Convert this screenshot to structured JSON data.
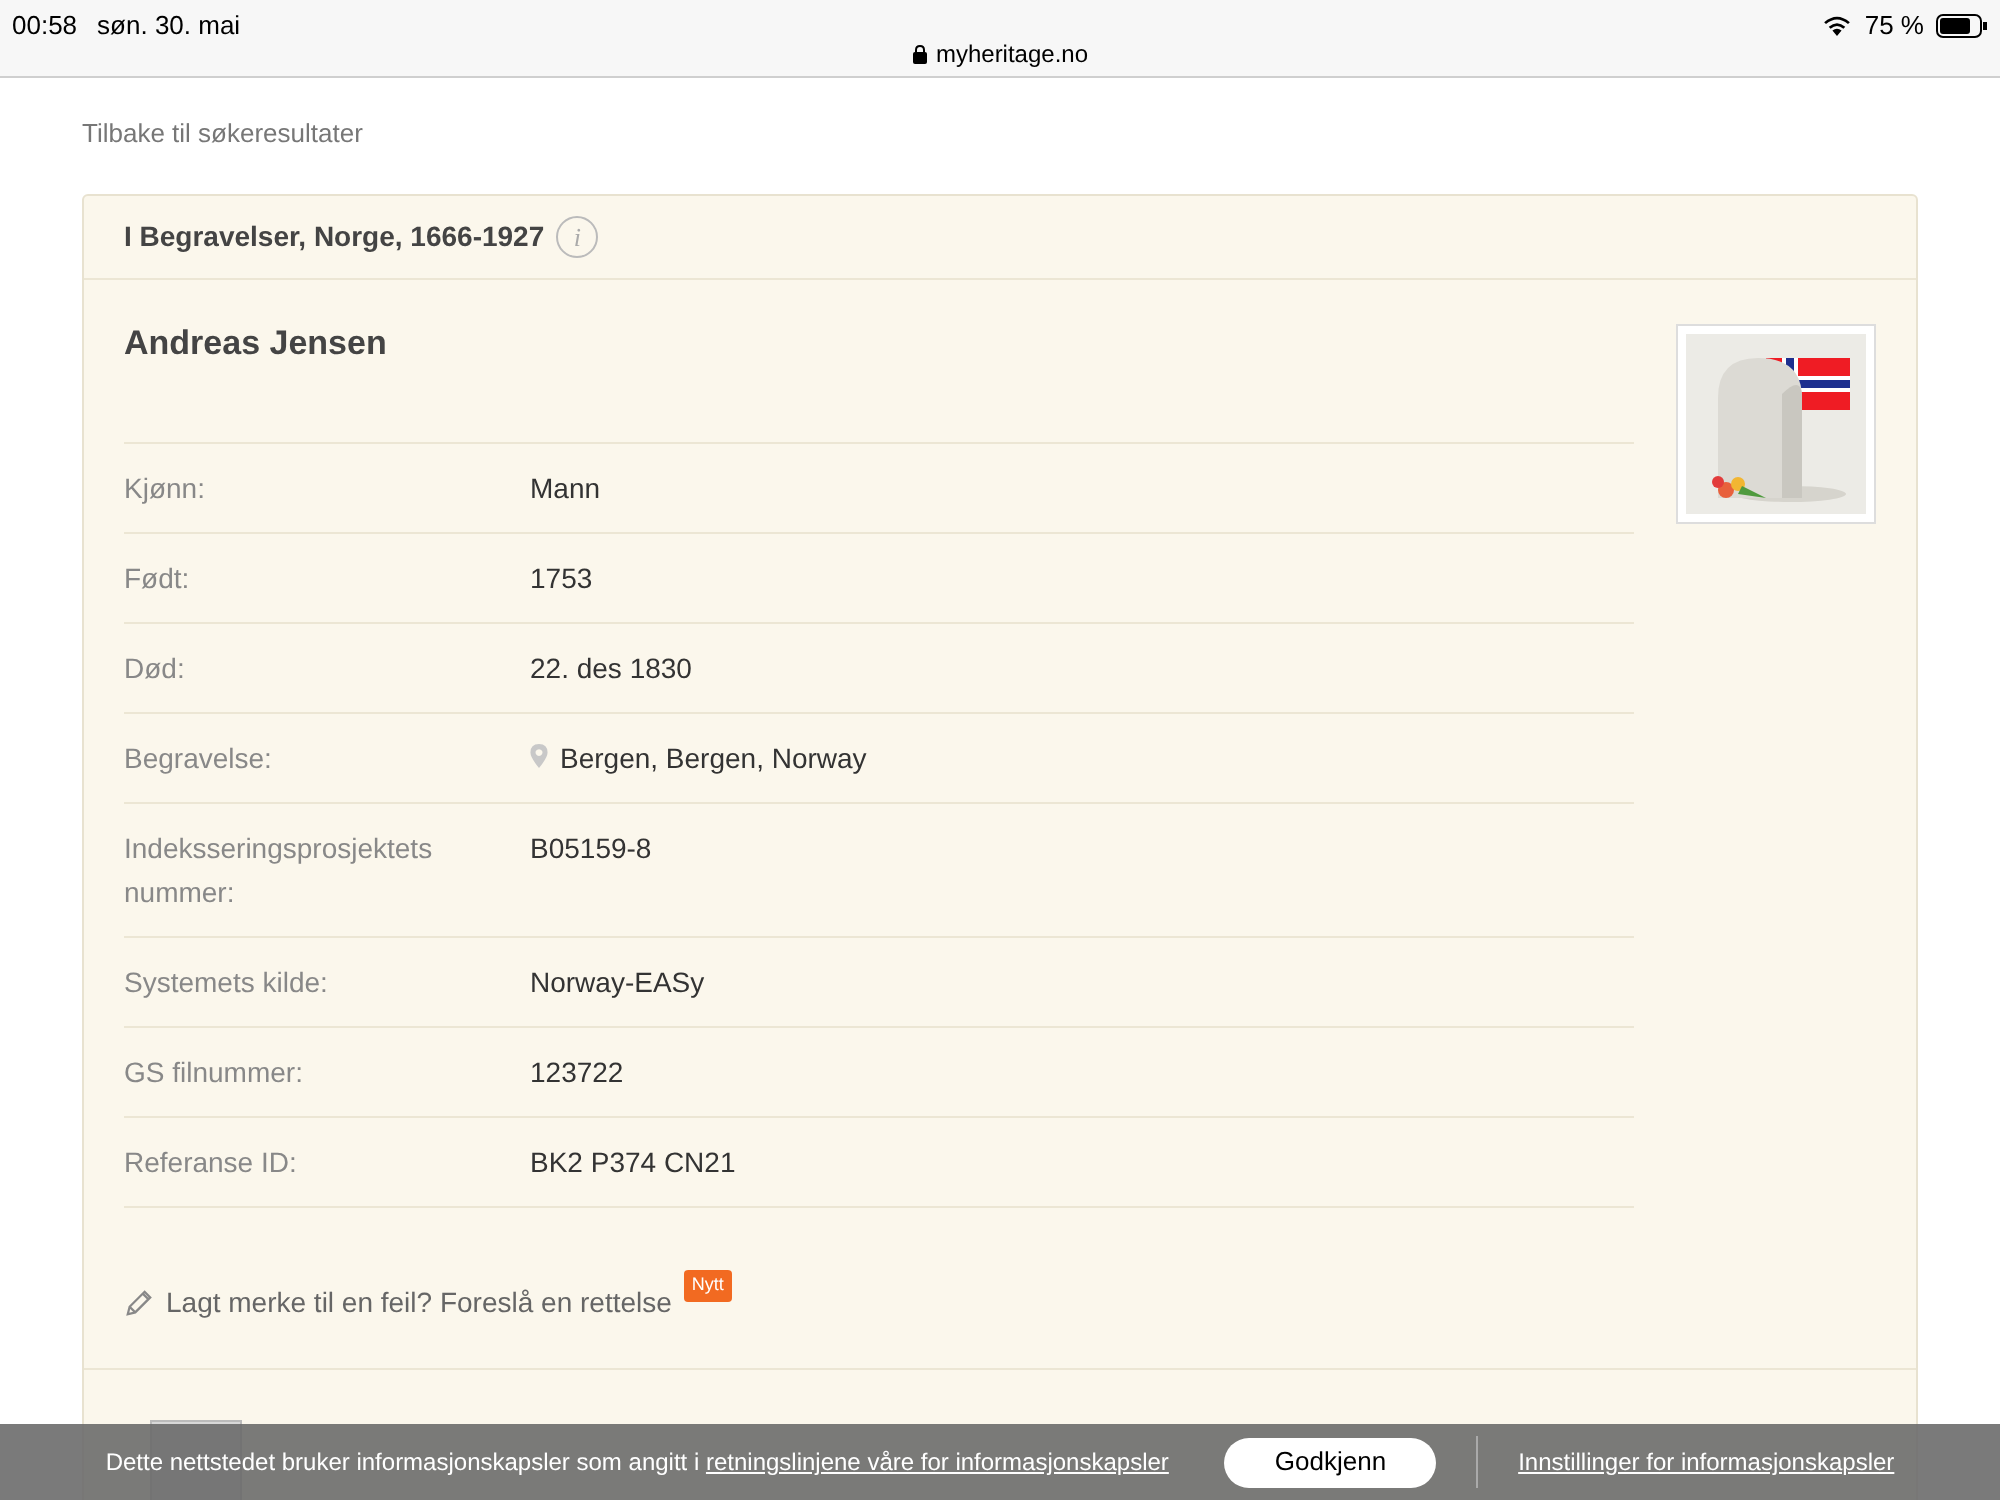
{
  "status_bar": {
    "time": "00:58",
    "date": "søn. 30. mai",
    "url": "myheritage.no",
    "battery": "75 %"
  },
  "back_link": "Tilbake til søkeresultater",
  "record": {
    "collection": "I Begravelser, Norge, 1666-1927",
    "info_icon": "i",
    "name": "Andreas Jensen",
    "fields": [
      {
        "label": "Kjønn:",
        "value": "Mann",
        "kind": "text"
      },
      {
        "label": "Født:",
        "value": "1753",
        "kind": "text"
      },
      {
        "label": "Død:",
        "value": "22. des 1830",
        "kind": "text"
      },
      {
        "label": "Begravelse:",
        "value": "Bergen, Bergen, Norway",
        "kind": "place"
      },
      {
        "label": "Indeksseringsprosjektets nummer:",
        "value": "B05159-8",
        "kind": "text"
      },
      {
        "label": "Systemets kilde:",
        "value": "Norway-EASy",
        "kind": "text"
      },
      {
        "label": "GS filnummer:",
        "value": "123722",
        "kind": "text"
      },
      {
        "label": "Referanse ID:",
        "value": "BK2 P374 CN21",
        "kind": "text"
      }
    ],
    "suggest": {
      "text": "Lagt merke til en feil? Foreslå en rettelse",
      "badge": "Nytt"
    }
  },
  "cookie_bar": {
    "text": "Dette nettstedet bruker informasjonskapsler som angitt i",
    "link": "retningslinjene våre for informasjonskapsler",
    "accept": "Godkjenn",
    "settings": "Innstillinger for informasjonskapsler"
  }
}
